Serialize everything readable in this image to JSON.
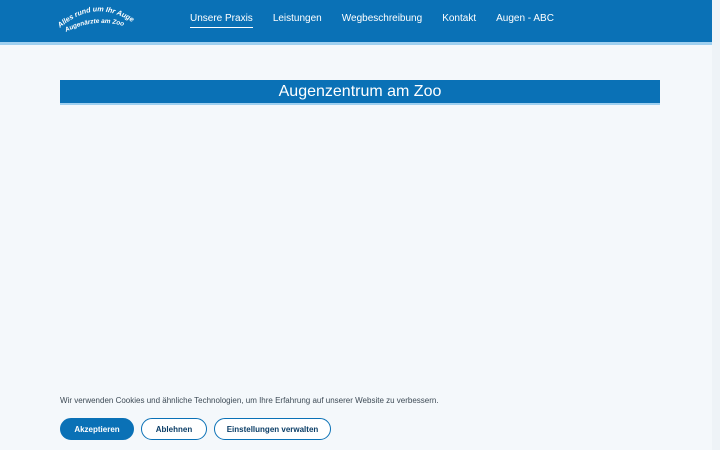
{
  "header": {
    "logo": {
      "line1": "Alles rund um Ihr Auge",
      "line2": "Augenärzte am Zoo"
    },
    "nav": [
      {
        "label": "Unsere Praxis",
        "active": true
      },
      {
        "label": "Leistungen",
        "active": false
      },
      {
        "label": "Wegbeschreibung",
        "active": false
      },
      {
        "label": "Kontakt",
        "active": false
      },
      {
        "label": "Augen - ABC",
        "active": false
      }
    ]
  },
  "main": {
    "title": "Augenzentrum am Zoo"
  },
  "cookie_banner": {
    "text": "Wir verwenden Cookies und ähnliche Technologien, um Ihre Erfahrung auf unserer Website zu verbessern.",
    "accept_label": "Akzeptieren",
    "decline_label": "Ablehnen",
    "settings_label": "Einstellungen verwalten"
  },
  "colors": {
    "brand": "#0a71b6",
    "accent_line": "#9fd0f0",
    "background": "#f4f8fb"
  }
}
